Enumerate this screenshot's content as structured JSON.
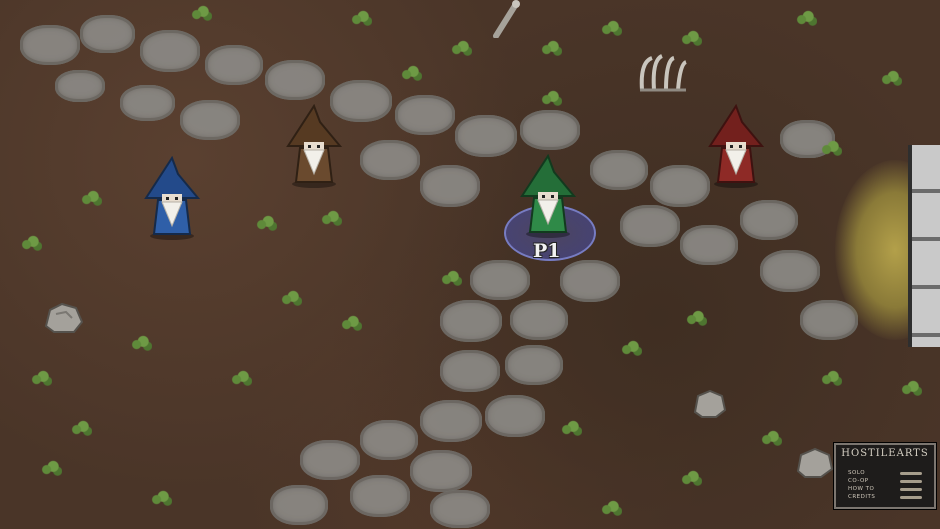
{
  "player_marker": {
    "label": "P1"
  },
  "menu": {
    "title": "HOSTILEARTS",
    "items": [
      {
        "label": "SOLO"
      },
      {
        "label": "CO-OP"
      },
      {
        "label": "HOW TO"
      },
      {
        "label": "CREDITS"
      }
    ]
  },
  "wizards": [
    {
      "name": "blue-wizard",
      "robe": "#2f5fa8",
      "hat": "#234a8a"
    },
    {
      "name": "brown-wizard",
      "robe": "#6a4a2e",
      "hat": "#563a22"
    },
    {
      "name": "green-wizard",
      "robe": "#2f8a48",
      "hat": "#246e38"
    },
    {
      "name": "red-wizard",
      "robe": "#8e2a26",
      "hat": "#73201d"
    }
  ],
  "colors": {
    "ground": "#4a3528",
    "stone": "#8c8a86",
    "grass": "#5f8a3a",
    "portal": "#b3a04a"
  }
}
